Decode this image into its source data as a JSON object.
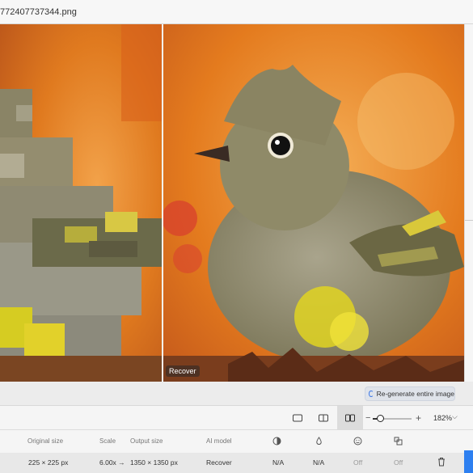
{
  "window": {
    "title": "772407737344.png"
  },
  "viewer": {
    "right_label": "Recover"
  },
  "regen": {
    "label": "Re-generate entire image"
  },
  "toolbar": {
    "views": [
      "single-view",
      "split-view",
      "side-by-side-view"
    ],
    "active_view": "side-by-side-view",
    "zoom": {
      "minus": "−",
      "plus": "+",
      "value": "182%",
      "level_fraction": 0.2,
      "chevron": "⌵"
    }
  },
  "table": {
    "headers": {
      "original_size": "Original size",
      "scale": "Scale",
      "output_size": "Output size",
      "ai_model": "AI model"
    },
    "header_icons": [
      "contrast-icon",
      "droplet-icon",
      "face-icon",
      "layers-icon"
    ],
    "row": {
      "original_size": "225 × 225 px",
      "scale": "6.00x →",
      "output_size": "1350 × 1350 px",
      "ai_model": "Recover",
      "col1": "N/A",
      "col2": "N/A",
      "col3": "Off",
      "col4": "Off"
    }
  },
  "colors": {
    "accent": "#2d7ff0",
    "bg_orange": "#e77a1e",
    "bird_olive": "#8d8460"
  }
}
